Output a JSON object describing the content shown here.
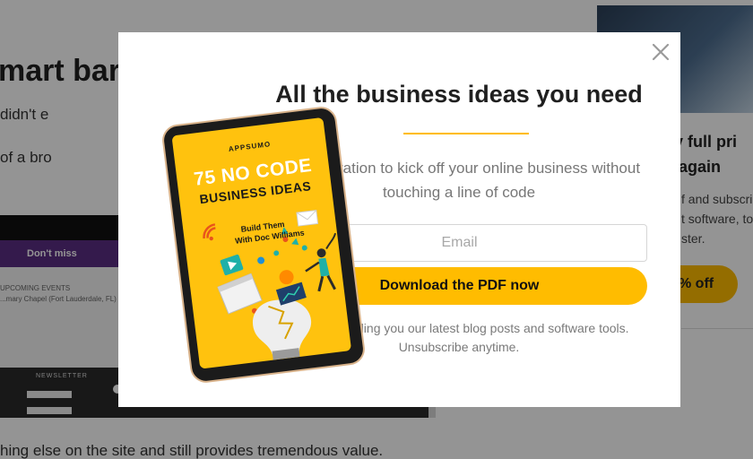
{
  "background_page": {
    "heading_fragment": "mart bar",
    "text_line_1": "didn't e",
    "text_line_2": "of a bro",
    "text_line_3": "hing else on the site and still provides tremendous value.",
    "screenshot": {
      "banner_text": "Don't miss",
      "events_heading": "UPCOMING EVENTS",
      "events_item": "...mary Chapel (Fort Lauderdale, FL)",
      "newsletter_label": "NEWSLETTER"
    },
    "right_card": {
      "title_line_1": "ay full pri",
      "title_line_2": "e again",
      "text_line_1": "f and subscri",
      "text_line_2": "t software, to",
      "text_line_3": "ster.",
      "button_label": "% off"
    }
  },
  "modal": {
    "title": "All the business ideas you need",
    "subtitle": "Get inspiration to kick off your online business without touching a line of code",
    "email_placeholder": "Email",
    "email_value": "",
    "download_button_label": "Download the PDF now",
    "disclaimer": "We'll be sending you our latest blog posts and software tools. Unsubscribe anytime.",
    "close_icon": "close-icon",
    "ebook_cover": {
      "brand": "APPSUMO",
      "title_line_1": "75 NO CODE",
      "title_line_2": "BUSINESS IDEAS",
      "subtitle_line_1": "Build Them",
      "subtitle_line_2": "With Doc Williams"
    }
  },
  "colors": {
    "accent": "#ffbc00",
    "overlay": "rgba(0,0,0,0.42)",
    "cover_background": "#ffc20e"
  }
}
